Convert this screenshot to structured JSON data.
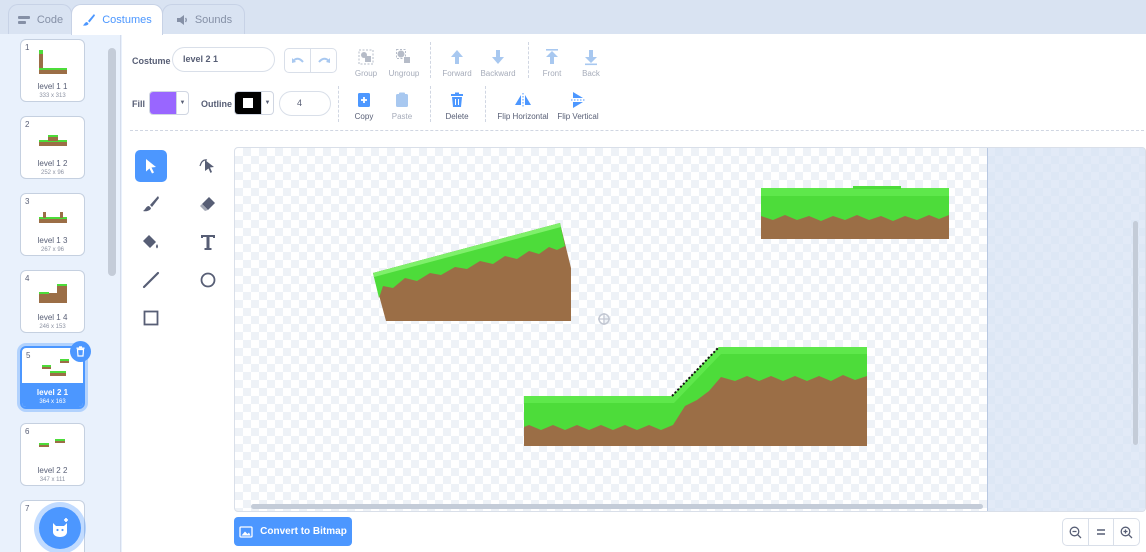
{
  "tabs": [
    {
      "label": "Code",
      "icon": "code-icon"
    },
    {
      "label": "Costumes",
      "icon": "brush-icon"
    },
    {
      "label": "Sounds",
      "icon": "speaker-icon"
    }
  ],
  "costumes": [
    {
      "number": "1",
      "name": "level 1 1",
      "dims": "333 x 313"
    },
    {
      "number": "2",
      "name": "level 1 2",
      "dims": "252 x 96"
    },
    {
      "number": "3",
      "name": "level 1 3",
      "dims": "267 x 96"
    },
    {
      "number": "4",
      "name": "level 1 4",
      "dims": "246 x 153"
    },
    {
      "number": "5",
      "name": "level 2 1",
      "dims": "364 x 163"
    },
    {
      "number": "6",
      "name": "level 2 2",
      "dims": "347 x 111"
    },
    {
      "number": "7",
      "name": "",
      "dims": ""
    }
  ],
  "editor": {
    "costume_label": "Costume",
    "costume_name": "level 2 1",
    "fill_label": "Fill",
    "outline_label": "Outline",
    "outline_width": "4",
    "fill_color": "#9966ff",
    "outline_color": "#000000",
    "group_label": "Group",
    "ungroup_label": "Ungroup",
    "forward_label": "Forward",
    "backward_label": "Backward",
    "front_label": "Front",
    "back_label": "Back",
    "copy_label": "Copy",
    "paste_label": "Paste",
    "delete_label": "Delete",
    "flip_h_label": "Flip Horizontal",
    "flip_v_label": "Flip Vertical",
    "convert_label": "Convert to Bitmap"
  },
  "colors": {
    "accent": "#4c97ff",
    "grass": "#4ddc3a",
    "dirt": "#9b6e46"
  }
}
